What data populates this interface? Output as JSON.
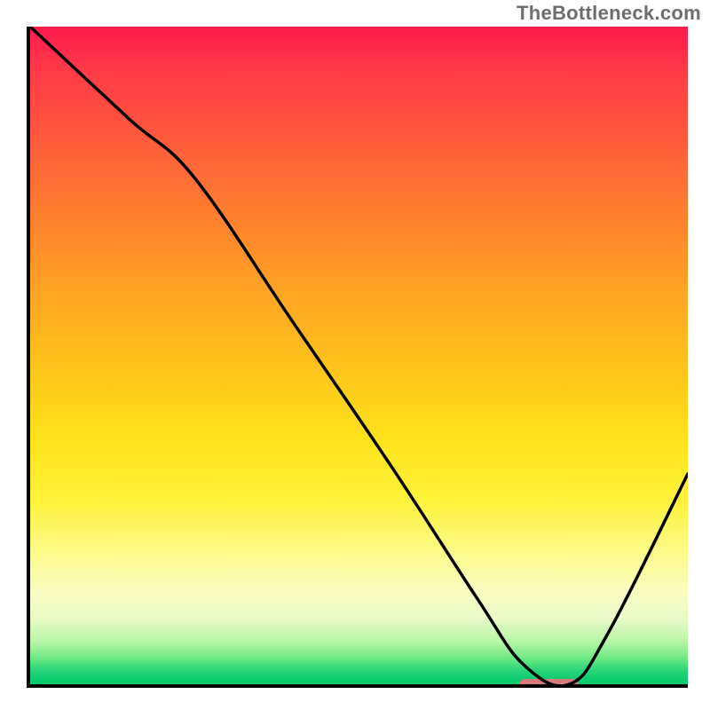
{
  "watermark": "TheBottleneck.com",
  "chart_data": {
    "type": "line",
    "title": "",
    "xlabel": "",
    "ylabel": "",
    "xlim": [
      0,
      100
    ],
    "ylim": [
      0,
      100
    ],
    "grid": false,
    "legend": false,
    "gradient_stops": [
      {
        "pos": 0,
        "color": "#ff1a4f"
      },
      {
        "pos": 17,
        "color": "#ff5a3c"
      },
      {
        "pos": 40,
        "color": "#ffa323"
      },
      {
        "pos": 63,
        "color": "#ffe31b"
      },
      {
        "pos": 86,
        "color": "#fafcc2"
      },
      {
        "pos": 96,
        "color": "#6fe985"
      },
      {
        "pos": 100,
        "color": "#00c96a"
      }
    ],
    "series": [
      {
        "name": "bottleneck-curve",
        "x": [
          0,
          15,
          25,
          40,
          55,
          68,
          75,
          82,
          88,
          100
        ],
        "values": [
          100,
          86,
          77,
          55,
          33,
          13,
          3,
          0,
          8,
          32
        ]
      }
    ],
    "optimum_marker": {
      "x_start": 74,
      "x_end": 83,
      "y": 0.5
    },
    "colors": {
      "curve": "#000000",
      "axis": "#000000",
      "marker": "#d97a7d",
      "watermark": "#6d6d6d"
    }
  }
}
